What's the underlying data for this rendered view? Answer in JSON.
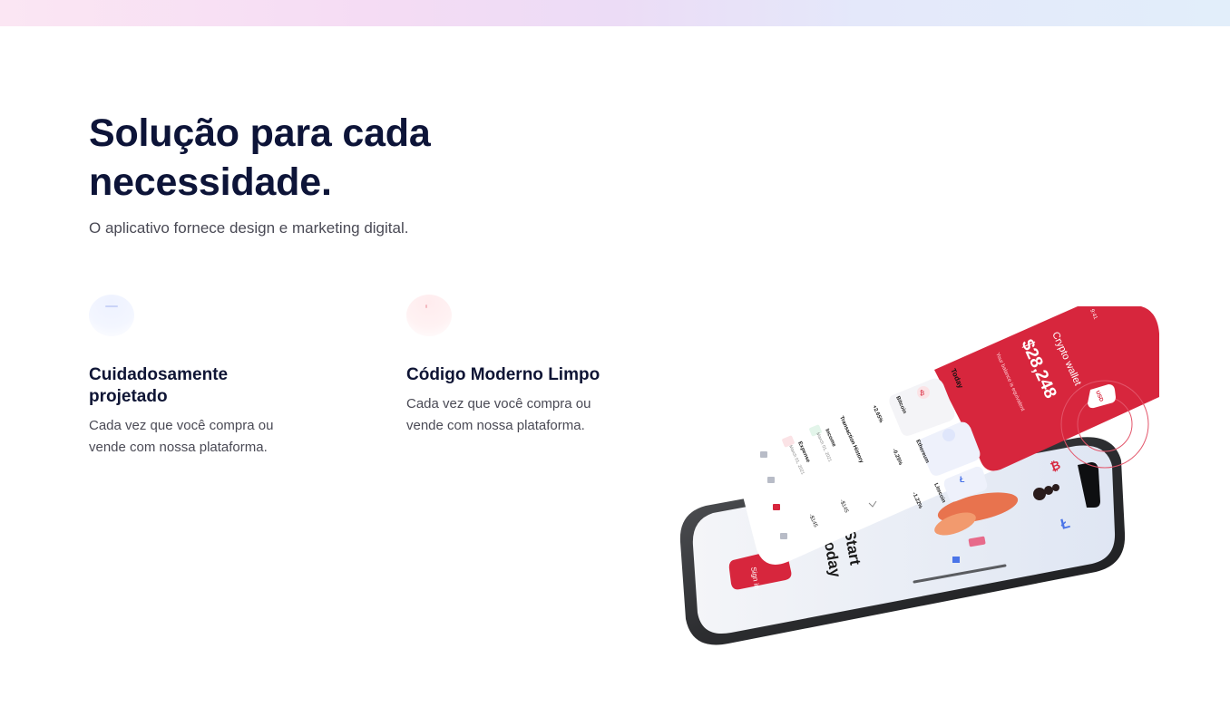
{
  "section": {
    "title": "Solução para cada necessidade.",
    "subtitle": "O aplicativo fornece design e marketing digital."
  },
  "features": [
    {
      "icon": "design-icon",
      "title": "Cuidadosamente projetado",
      "description": "Cada vez que você compra ou vende com nossa plataforma."
    },
    {
      "icon": "code-icon",
      "title": "Código Moderno Limpo",
      "description": "Cada vez que você compra ou vende com nossa plataforma."
    }
  ],
  "phone_mockup": {
    "wallet_title": "Crypto wallet",
    "balance": "$28,248",
    "balance_note": "Your balance is equivalent",
    "currency": "USD",
    "time": "9:41",
    "today_label": "Today",
    "history_label": "Transaction History",
    "assets": [
      {
        "name": "Bitcoin",
        "change": "+2.65%"
      },
      {
        "name": "Ethereum",
        "change": "-0.25%"
      },
      {
        "name": "Litecoin",
        "change": "-1.22%"
      }
    ],
    "transactions": [
      {
        "name": "Income",
        "date": "March 01, 2021",
        "amount": "-$145"
      },
      {
        "name": "Expense",
        "date": "March 01, 2021",
        "amount": "-$145"
      }
    ],
    "back_screen_heading_1": "Start",
    "back_screen_heading_2": "today",
    "sign_in_label": "Sign in",
    "colors": {
      "brand_red": "#d7263d",
      "heading_navy": "#0d1438"
    }
  }
}
